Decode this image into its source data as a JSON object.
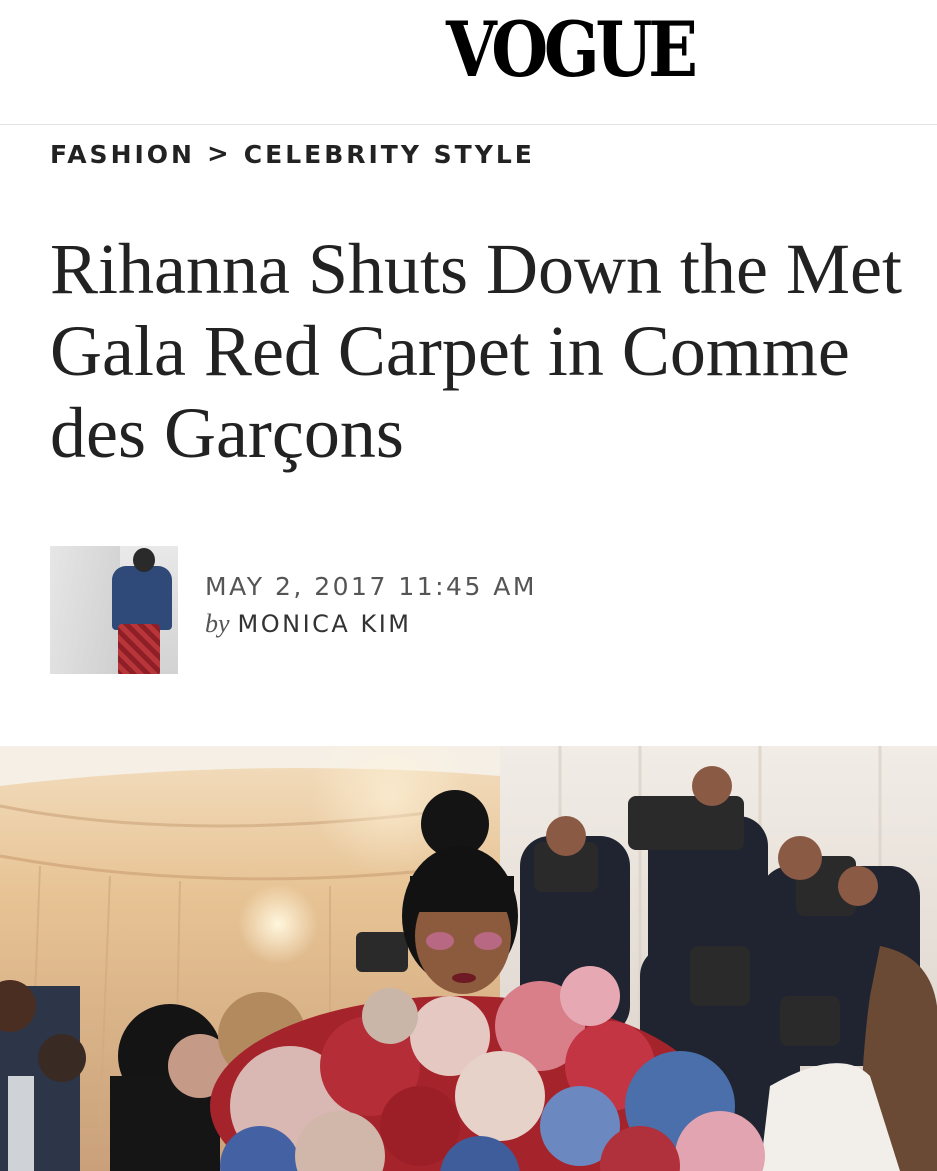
{
  "masthead": {
    "logo": "VOGUE"
  },
  "breadcrumb": {
    "section": "FASHION",
    "separator": ">",
    "subsection": "CELEBRITY STYLE"
  },
  "article": {
    "headline": "Rihanna Shuts Down the Met Gala Red Carpet in Comme des Garçons",
    "date": "MAY 2, 2017 11:45 AM",
    "by_word": "by",
    "author": "MONICA KIM"
  },
  "images": {
    "author_thumb": "author-photo",
    "hero": "red-carpet-photo"
  }
}
